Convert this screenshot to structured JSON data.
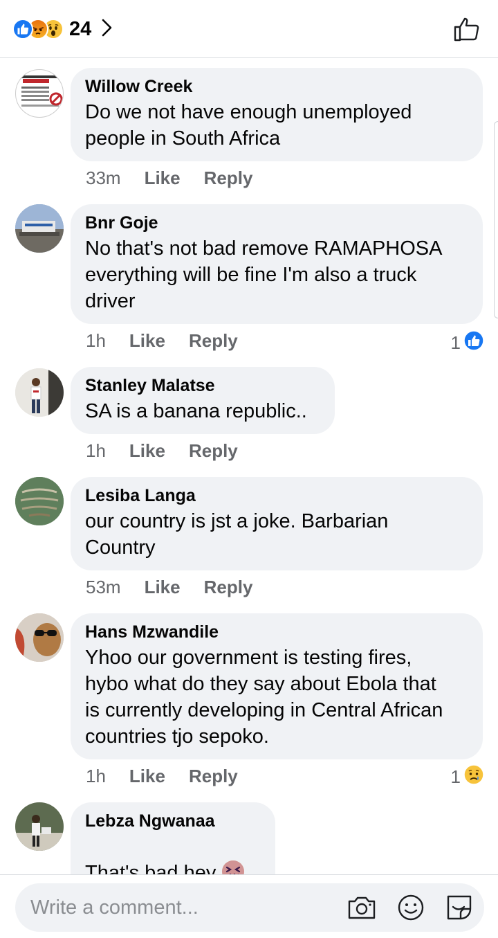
{
  "header": {
    "reaction_icons": [
      "like-reaction",
      "angry-reaction",
      "wow-reaction"
    ],
    "reaction_count": "24",
    "colors": {
      "like": "#1877f2",
      "angry": "#e9710f",
      "wow": "#f7c33b"
    }
  },
  "comments": [
    {
      "name": "Willow Creek",
      "text": "Do we not have enough unemployed\npeople in South Africa",
      "time": "33m",
      "like": "Like",
      "reply": "Reply"
    },
    {
      "name": "Bnr Goje",
      "text": "No that's not bad remove RAMAPHOSA\neverything will be fine I'm also a truck\ndriver",
      "time": "1h",
      "like": "Like",
      "reply": "Reply",
      "reactions": "1",
      "reaction_icon": "like-reaction"
    },
    {
      "name": "Stanley Malatse",
      "text": "SA is a banana republic..",
      "time": "1h",
      "like": "Like",
      "reply": "Reply"
    },
    {
      "name": "Lesiba Langa",
      "text": "our country is jst a joke. Barbarian\nCountry",
      "time": "53m",
      "like": "Like",
      "reply": "Reply"
    },
    {
      "name": "Hans Mzwandile",
      "text": "Yhoo our government is testing fires,\nhybo what do they say about Ebola that\nis currently developing in Central African\ncountries tjo sepoko.",
      "time": "1h",
      "like": "Like",
      "reply": "Reply",
      "reactions": "1",
      "reaction_icon": "sad-reaction"
    },
    {
      "name": "Lebza Ngwanaa",
      "text": "That's bad hey",
      "emoji": "confounded-face"
    }
  ],
  "composer": {
    "placeholder": "Write a comment...",
    "icons": [
      "camera-icon",
      "emoji-icon",
      "sticker-icon"
    ]
  }
}
